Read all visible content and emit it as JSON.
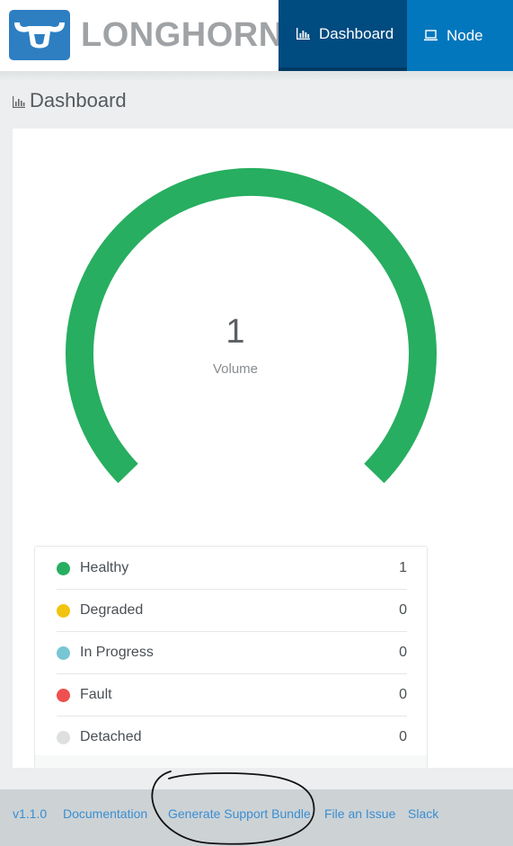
{
  "header": {
    "brand": "LONGHORN",
    "nav": [
      {
        "label": "Dashboard",
        "active": true
      },
      {
        "label": "Node",
        "active": false
      }
    ]
  },
  "page": {
    "title": "Dashboard"
  },
  "gauge": {
    "count": "1",
    "label": "Volume",
    "color": "#27ae60"
  },
  "legend": [
    {
      "name": "Healthy",
      "count": "1",
      "color": "#27ae60"
    },
    {
      "name": "Degraded",
      "count": "0",
      "color": "#f1c40f"
    },
    {
      "name": "In Progress",
      "count": "0",
      "color": "#78c6d3"
    },
    {
      "name": "Fault",
      "count": "0",
      "color": "#ef4f4f"
    },
    {
      "name": "Detached",
      "count": "0",
      "color": "#dddfe1"
    }
  ],
  "footer": {
    "version": "v1.1.0",
    "documentation": "Documentation",
    "support_bundle": "Generate Support Bundle",
    "file_issue": "File an Issue",
    "slack": "Slack"
  },
  "colors": {
    "nav_active": "#004b80",
    "nav_inactive": "#0277bd",
    "logo": "#2d7fc2",
    "link": "#3a8ed1"
  }
}
